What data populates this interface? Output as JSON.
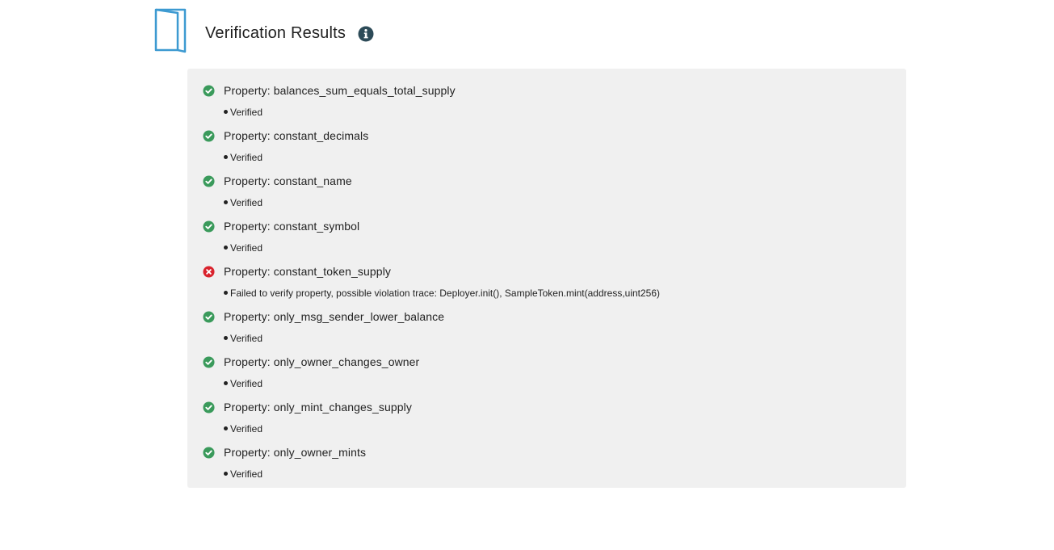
{
  "header": {
    "title": "Verification Results",
    "icon": "document-icon",
    "info_icon": "info-icon"
  },
  "colors": {
    "verified": "#3a9a5b",
    "failed": "#d9232d",
    "panel_bg": "#f0f0f0",
    "doc_icon": "#3d9ad1",
    "info_icon": "#2d4b58"
  },
  "properties": [
    {
      "label": "Property: balances_sum_equals_total_supply",
      "status": "verified",
      "detail": "Verified"
    },
    {
      "label": "Property: constant_decimals",
      "status": "verified",
      "detail": "Verified"
    },
    {
      "label": "Property: constant_name",
      "status": "verified",
      "detail": "Verified"
    },
    {
      "label": "Property: constant_symbol",
      "status": "verified",
      "detail": "Verified"
    },
    {
      "label": "Property: constant_token_supply",
      "status": "failed",
      "detail": "Failed to verify property, possible violation trace: Deployer.init(), SampleToken.mint(address,uint256)"
    },
    {
      "label": "Property: only_msg_sender_lower_balance",
      "status": "verified",
      "detail": "Verified"
    },
    {
      "label": "Property: only_owner_changes_owner",
      "status": "verified",
      "detail": "Verified"
    },
    {
      "label": "Property: only_mint_changes_supply",
      "status": "verified",
      "detail": "Verified"
    },
    {
      "label": "Property: only_owner_mints",
      "status": "verified",
      "detail": "Verified"
    }
  ]
}
